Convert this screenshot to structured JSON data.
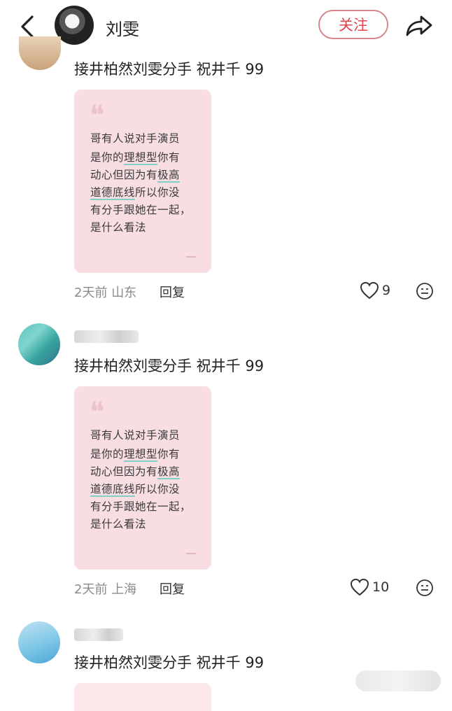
{
  "header": {
    "username": "刘雯",
    "follow_label": "关注"
  },
  "comments": [
    {
      "text": "接井柏然刘雯分手 祝井千 99",
      "card_lines": [
        "哥有人说对手演员",
        "是你的理想型你有",
        "动心但因为有极高",
        "道德底线所以你没",
        "有分手跟她在一起，",
        "是什么看法"
      ],
      "time": "2天前",
      "location": "山东",
      "reply_label": "回复",
      "likes": "9"
    },
    {
      "text": "接井柏然刘雯分手 祝井千 99",
      "card_lines": [
        "哥有人说对手演员",
        "是你的理想型你有",
        "动心但因为有极高",
        "道德底线所以你没",
        "有分手跟她在一起，",
        "是什么看法"
      ],
      "time": "2天前",
      "location": "上海",
      "reply_label": "回复",
      "likes": "10"
    },
    {
      "text": "接井柏然刘雯分手 祝井千 99"
    }
  ],
  "colors": {
    "accent": "#e0444e",
    "card_bg": "#f8dde3",
    "highlight_underline": "#7fd0c6"
  }
}
